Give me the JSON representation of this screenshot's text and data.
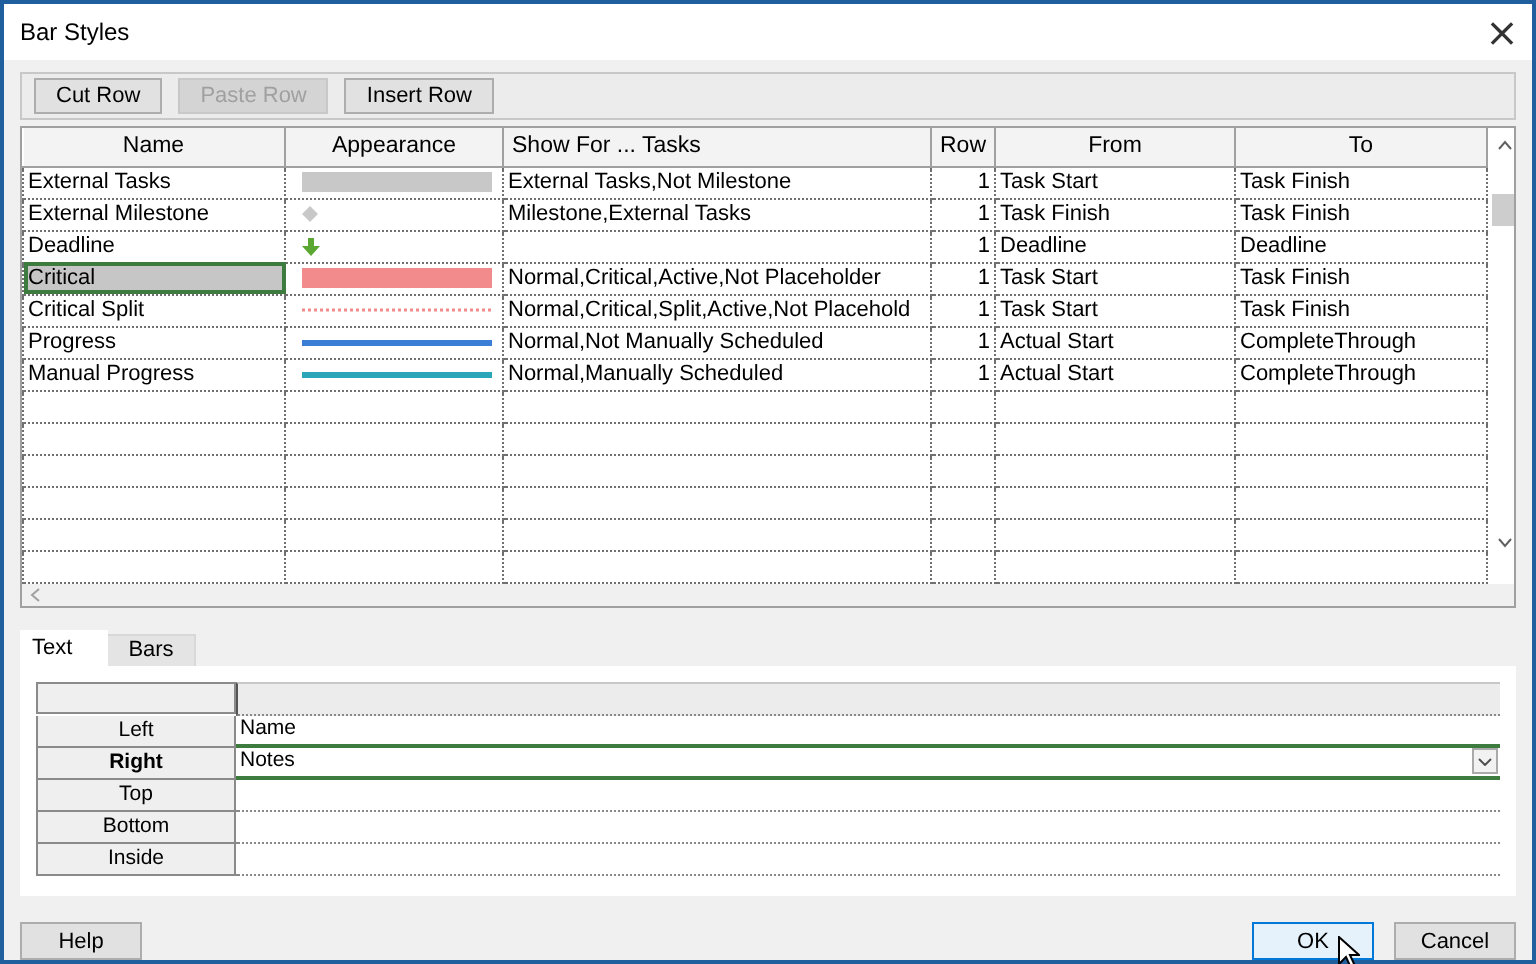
{
  "window": {
    "title": "Bar Styles",
    "close": "×"
  },
  "toolbar": [
    {
      "label": "Cut Row",
      "disabled": false
    },
    {
      "label": "Paste Row",
      "disabled": true
    },
    {
      "label": "Insert Row",
      "disabled": false
    }
  ],
  "table": {
    "columns": [
      "Name",
      "Appearance",
      "Show For ... Tasks",
      "Row",
      "From",
      "To"
    ],
    "rows": [
      {
        "name": "External Tasks",
        "appearance": {
          "kind": "bar",
          "color": "#c8c8c8"
        },
        "show_for": "External Tasks,Not Milestone",
        "row": "1",
        "from": "Task Start",
        "to": "Task Finish",
        "selected": false
      },
      {
        "name": "External Milestone",
        "appearance": {
          "kind": "diamond",
          "color": "#c8c8c8"
        },
        "show_for": "Milestone,External Tasks",
        "row": "1",
        "from": "Task Finish",
        "to": "Task Finish",
        "selected": false
      },
      {
        "name": "Deadline",
        "appearance": {
          "kind": "arrow",
          "color": "#5aa832"
        },
        "row": "1",
        "from": "Deadline",
        "to": "Deadline",
        "selected": false
      },
      {
        "name": "Critical",
        "appearance": {
          "kind": "bar",
          "color": "#f28b8b"
        },
        "show_for": "Normal,Critical,Active,Not Placeholder",
        "row": "1",
        "from": "Task Start",
        "to": "Task Finish",
        "selected": true
      },
      {
        "name": "Critical Split",
        "appearance": {
          "kind": "dotted",
          "color": "#f28b8b"
        },
        "show_for": "Normal,Critical,Split,Active,Not Placehold",
        "row": "1",
        "from": "Task Start",
        "to": "Task Finish",
        "selected": false
      },
      {
        "name": "Progress",
        "appearance": {
          "kind": "line",
          "color": "#3a7fd5"
        },
        "show_for": "Normal,Not Manually Scheduled",
        "row": "1",
        "from": "Actual Start",
        "to": "CompleteThrough",
        "selected": false
      },
      {
        "name": "Manual Progress",
        "appearance": {
          "kind": "line",
          "color": "#2aa6b8"
        },
        "show_for": "Normal,Manually Scheduled",
        "row": "1",
        "from": "Actual Start",
        "to": "CompleteThrough",
        "selected": false
      }
    ]
  },
  "tabs": [
    {
      "label": "Text",
      "selected": true
    },
    {
      "label": "Bars",
      "selected": false
    }
  ],
  "text_grid": [
    {
      "label": "Left",
      "value": "Name",
      "selected": false
    },
    {
      "label": "Right",
      "value": "Notes",
      "selected": true
    },
    {
      "label": "Top",
      "selected": false
    },
    {
      "label": "Bottom",
      "selected": false
    },
    {
      "label": "Inside",
      "selected": false
    }
  ],
  "buttons": [
    {
      "label": "Help",
      "kind": "help"
    },
    {
      "label": "OK",
      "kind": "default"
    },
    {
      "label": "Cancel",
      "kind": "normal"
    }
  ]
}
